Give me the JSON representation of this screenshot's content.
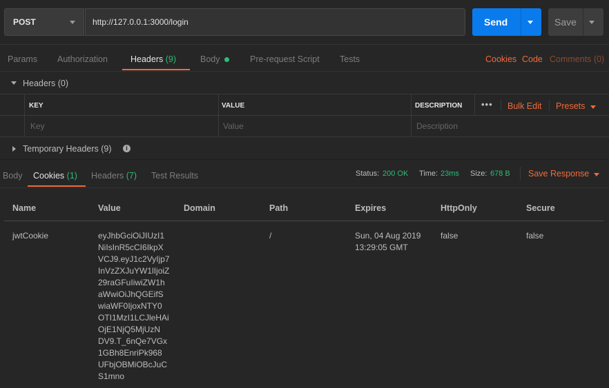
{
  "request": {
    "method": "POST",
    "url": "http://127.0.0.1:3000/login",
    "send_label": "Send",
    "save_label": "Save"
  },
  "request_tabs": {
    "params": "Params",
    "authorization": "Authorization",
    "headers": "Headers",
    "headers_count": "(9)",
    "body": "Body",
    "prerequest": "Pre-request Script",
    "tests": "Tests"
  },
  "request_right": {
    "cookies": "Cookies",
    "code": "Code",
    "comments": "Comments (0)"
  },
  "headers_section": {
    "title": "Headers (0)",
    "columns": {
      "key": "KEY",
      "value": "VALUE",
      "description": "DESCRIPTION"
    },
    "placeholders": {
      "key": "Key",
      "value": "Value",
      "description": "Description"
    },
    "more": "•••",
    "bulk_edit": "Bulk Edit",
    "presets": "Presets",
    "temporary": "Temporary Headers (9)"
  },
  "response_tabs": {
    "body": "Body",
    "cookies": "Cookies",
    "cookies_count": "(1)",
    "headers": "Headers",
    "headers_count": "(7)",
    "test_results": "Test Results"
  },
  "status": {
    "status_label": "Status:",
    "status_value": "200 OK",
    "time_label": "Time:",
    "time_value": "23ms",
    "size_label": "Size:",
    "size_value": "678 B",
    "save_response": "Save Response"
  },
  "cookies_table": {
    "columns": {
      "name": "Name",
      "value": "Value",
      "domain": "Domain",
      "path": "Path",
      "expires": "Expires",
      "httponly": "HttpOnly",
      "secure": "Secure"
    },
    "row": {
      "name": "jwtCookie",
      "value": "eyJhbGciOiJIUzI1NiIsInR5cCI6IkpXVCJ9.eyJ1c2VyIjp7InVzZXJuYW1lIjoiZ29raGFuIiwiZW1haWwiOiJhQGEifSwiaWF0IjoxNTY0OTI1MzI1LCJleHAiOjE1NjQ5MjUzNDV9.T_6nQe7VGx1GBh8EnriPk968UFbjOBMiOBcJuCS1mno",
      "value_lines": [
        "eyJhbGciOiJIUzI1",
        "NiIsInR5cCI6IkpX",
        "VCJ9.eyJ1c2VyIjp7",
        "InVzZXJuYW1lIjoiZ",
        "29raGFuIiwiZW1h",
        "aWwiOiJhQGEifS",
        "wiaWF0IjoxNTY0",
        "OTI1MzI1LCJleHAi",
        "OjE1NjQ5MjUzN",
        "DV9.T_6nQe7VGx",
        "1GBh8EnriPk968",
        "UFbjOBMiOBcJuC",
        "S1mno"
      ],
      "domain": "",
      "path": "/",
      "expires_line1": "Sun, 04 Aug 2019",
      "expires_line2": "13:29:05 GMT",
      "httponly": "false",
      "secure": "false"
    }
  },
  "colors": {
    "accent": "#f26b3a",
    "send": "#097bed",
    "success": "#2cbd76",
    "background": "#262626"
  }
}
